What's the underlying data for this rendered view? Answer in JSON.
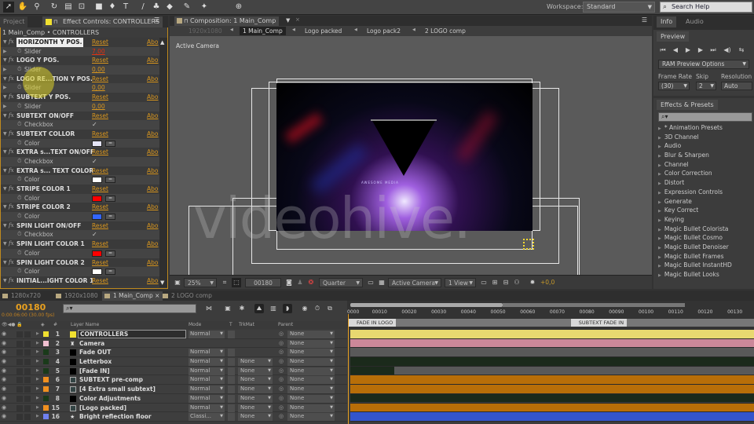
{
  "toolbar": {
    "icons": [
      "selection-tool",
      "hand-tool",
      "zoom-tool",
      "rotation-tool",
      "camera-tool",
      "pan-behind-tool",
      "rectangle-tool",
      "pen-tool",
      "text-tool",
      "brush-tool",
      "clone-stamp-tool",
      "eraser-tool",
      "roto-brush-tool",
      "puppet-tool"
    ],
    "workspace_label": "Workspace:",
    "workspace_value": "Standard",
    "search_help_placeholder": "Search Help"
  },
  "left_panel": {
    "tabs": [
      "Project",
      "Effect Controls: CONTROLLERS"
    ],
    "breadcrumb": "1 Main_Comp • CONTROLLERS",
    "effects": [
      {
        "name": "HORIZONTH Y POS.",
        "selected": true,
        "reset": "Reset",
        "about": "Abo",
        "prop": "Slider",
        "value": "7,00",
        "value_type": "slider-red"
      },
      {
        "name": "LOGO Y POS.",
        "reset": "Reset",
        "about": "Abo",
        "prop": "Slider",
        "value": "0,00",
        "value_type": "slider"
      },
      {
        "name": "LOGO RE...TION Y POS.",
        "reset": "Reset",
        "about": "Abo",
        "prop": "Slider",
        "value": "0,00",
        "value_type": "slider"
      },
      {
        "name": "SUBTEXT Y POS.",
        "reset": "Reset",
        "about": "Abo",
        "prop": "Slider",
        "value": "0,00",
        "value_type": "slider"
      },
      {
        "name": "SUBTEXT ON/OFF",
        "reset": "Reset",
        "about": "Abo",
        "prop": "Checkbox",
        "value": "✓",
        "value_type": "checkbox"
      },
      {
        "name": "SUBTEXT COLLOR",
        "reset": "Reset",
        "about": "Abo",
        "prop": "Color",
        "value": "#e4e4f6",
        "value_type": "color"
      },
      {
        "name": "EXTRA s...TEXT ON/OFF",
        "reset": "Reset",
        "about": "Abo",
        "prop": "Checkbox",
        "value": "✓",
        "value_type": "checkbox"
      },
      {
        "name": "EXTRA s... TEXT COLOR",
        "reset": "Reset",
        "about": "Abo",
        "prop": "Color",
        "value": "#ffffff",
        "value_type": "color"
      },
      {
        "name": "STRIPE COLOR 1",
        "reset": "Reset",
        "about": "Abo",
        "prop": "Color",
        "value": "#ff0000",
        "value_type": "color"
      },
      {
        "name": "STRIPE COLOR 2",
        "reset": "Reset",
        "about": "Abo",
        "prop": "Color",
        "value": "#3366ff",
        "value_type": "color"
      },
      {
        "name": "SPIN LIGHT ON/OFF",
        "reset": "Reset",
        "about": "Abo",
        "prop": "Checkbox",
        "value": "✓",
        "value_type": "checkbox"
      },
      {
        "name": "SPIN LIGHT COLOR 1",
        "reset": "Reset",
        "about": "Abo",
        "prop": "Color",
        "value": "#ff0000",
        "value_type": "color"
      },
      {
        "name": "SPIN LIGHT COLOR 2",
        "reset": "Reset",
        "about": "Abo",
        "prop": "Color",
        "value": "#ffffff",
        "value_type": "color"
      },
      {
        "name": "INITIAL...IGHT COLOR 1",
        "reset": "Reset",
        "about": "Abo"
      }
    ]
  },
  "comp_panel": {
    "tab_title": "Composition: 1 Main_Comp",
    "breadcrumbs": [
      "1920x1080",
      "1 Main_Comp",
      "Logo packed",
      "Logo pack2",
      "2 LOGO comp"
    ],
    "active_crumb": 1,
    "view_label": "Active Camera",
    "watermark": "videohive.",
    "render_title": "AWESOME MEDIA",
    "viewer_bar": {
      "zoom": "25%",
      "timecode": "00180",
      "resolution": "Quarter",
      "camera": "Active Camera",
      "views": "1 View",
      "exposure": "+0,0"
    }
  },
  "info_panel": {
    "tabs": [
      "Info",
      "Audio"
    ]
  },
  "preview_panel": {
    "tab": "Preview",
    "ram_options": "RAM Preview Options",
    "frame_rate_label": "Frame Rate",
    "frame_rate": "(30)",
    "skip_label": "Skip",
    "skip": "2",
    "resolution_label": "Resolution",
    "resolution": "Auto"
  },
  "effects_presets": {
    "tab": "Effects & Presets",
    "items": [
      "* Animation Presets",
      "3D Channel",
      "Audio",
      "Blur & Sharpen",
      "Channel",
      "Color Correction",
      "Distort",
      "Expression Controls",
      "Generate",
      "Key Correct",
      "Keying",
      "Magic Bullet Colorista",
      "Magic Bullet Cosmo",
      "Magic Bullet Denoiser",
      "Magic Bullet Frames",
      "Magic Bullet InstantHD",
      "Magic Bullet Looks"
    ]
  },
  "timeline": {
    "tabs": [
      "1280x720",
      "1920x1080",
      "1 Main_Comp",
      "2 LOGO comp"
    ],
    "active_tab": 2,
    "current_time": "00180",
    "time_detail": "0:00:06:00 (30.00 fps)",
    "headers": {
      "layer_name": "Layer Name",
      "mode": "Mode",
      "t": "T",
      "trkmat": "TrkMat",
      "parent": "Parent",
      "num": "#"
    },
    "ruler_ticks": [
      "0000",
      "00010",
      "00020",
      "00030",
      "00040",
      "00050",
      "00060",
      "00070",
      "00080",
      "00090",
      "00100",
      "00110",
      "00120",
      "00130"
    ],
    "markers": [
      {
        "label": "FADE IN LOGO",
        "frame": 0
      },
      {
        "label": "SUBTEXT FADE IN",
        "frame": 75
      }
    ],
    "layers": [
      {
        "num": "1",
        "name": "CONTROLLERS",
        "label": "#f0e030",
        "src": "#f0e030",
        "mode": "Normal",
        "trkmat": null,
        "parent": "None",
        "bar": "#e8d870",
        "selected": true
      },
      {
        "num": "2",
        "name": "Camera",
        "label": "#f0c0d0",
        "src": "camera",
        "mode": null,
        "trkmat": null,
        "parent": "None",
        "bar": "#cc8899"
      },
      {
        "num": "3",
        "name": "Fade OUT",
        "label": "#1a3a1a",
        "src": "#000000",
        "mode": "Normal",
        "trkmat": null,
        "parent": "None",
        "bar": "#595959"
      },
      {
        "num": "4",
        "name": "Letterbox",
        "label": "#1a3a1a",
        "src": "#000000",
        "mode": "Normal",
        "trkmat": "None",
        "parent": "None",
        "bar": "#1b2a1b"
      },
      {
        "num": "5",
        "name": "[Fade IN]",
        "label": "#1a3a1a",
        "src": "#000000",
        "mode": "Normal",
        "trkmat": "None",
        "parent": "None",
        "bar": "#595959",
        "bar_short": "#1b2a1b"
      },
      {
        "num": "6",
        "name": "SUBTEXT pre-comp",
        "label": "#f09020",
        "src": "comp",
        "mode": "Normal",
        "trkmat": "None",
        "parent": "None",
        "bar": "#b86e08"
      },
      {
        "num": "7",
        "name": "[4 Extra small subtext]",
        "label": "#f09020",
        "src": "comp",
        "mode": "Normal",
        "trkmat": "None",
        "parent": "None",
        "bar": "#b86e08"
      },
      {
        "num": "8",
        "name": "Color Adjustments",
        "label": "#1a3a1a",
        "src": "#000000",
        "mode": "Normal",
        "trkmat": "None",
        "parent": "None",
        "bar": "#1b2a1b"
      },
      {
        "num": "15",
        "name": "[Logo packed]",
        "label": "#f09020",
        "src": "comp",
        "mode": "Normal",
        "trkmat": "None",
        "parent": "None",
        "bar": "#b86e08"
      },
      {
        "num": "16",
        "name": "Bright reflection floor",
        "label": "#7080ee",
        "src": "light",
        "mode": "Classi...",
        "trkmat": "None",
        "parent": "None",
        "bar": "#3355cc"
      }
    ]
  }
}
